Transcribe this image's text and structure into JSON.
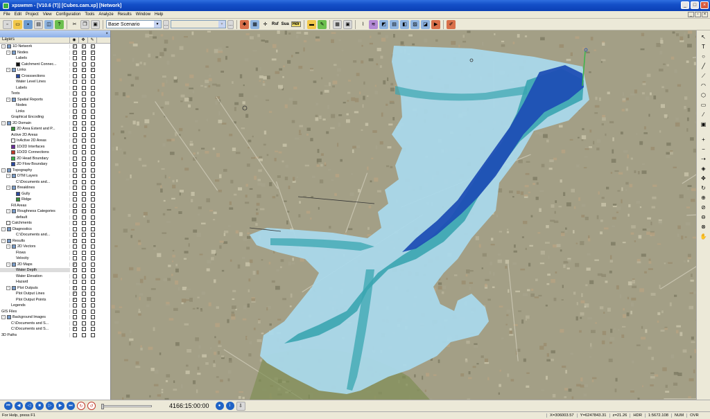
{
  "window": {
    "title": "xpswmm - [V10.6 (T)] [Cubes.cam.xp] [Network]"
  },
  "menu": [
    "File",
    "Edit",
    "Project",
    "View",
    "Configuration",
    "Tools",
    "Analyze",
    "Results",
    "Window",
    "Help"
  ],
  "toolbar": {
    "scenario": "Base Scenario",
    "rsf_label": "Rsf",
    "sua_label": "Sua",
    "hdr_label": "Hdr"
  },
  "panel": {
    "title": "",
    "column_header": "Layers"
  },
  "layers": [
    {
      "label": "1D Network",
      "indent": 0,
      "exp": "-",
      "icon": "#7a9cc8",
      "c": [
        1,
        1,
        1
      ]
    },
    {
      "label": "Nodes",
      "indent": 1,
      "exp": "-",
      "icon": "#7a9cc8",
      "c": [
        1,
        1,
        1
      ]
    },
    {
      "label": "Labels",
      "indent": 3,
      "exp": "",
      "icon": "",
      "c": [
        0,
        0,
        0
      ]
    },
    {
      "label": "Catchment Connec...",
      "indent": 3,
      "exp": "",
      "icon": "#111111",
      "c": [
        0,
        0,
        0
      ]
    },
    {
      "label": "Links",
      "indent": 1,
      "exp": "-",
      "icon": "#7a9cc8",
      "c": [
        1,
        1,
        1
      ]
    },
    {
      "label": "Crosssections",
      "indent": 3,
      "exp": "",
      "icon": "#2b4aa0",
      "c": [
        0,
        0,
        0
      ]
    },
    {
      "label": "Water Level Lines",
      "indent": 3,
      "exp": "",
      "icon": "",
      "c": [
        0,
        0,
        0
      ]
    },
    {
      "label": "Labels",
      "indent": 3,
      "exp": "",
      "icon": "",
      "c": [
        0,
        0,
        0
      ]
    },
    {
      "label": "Texts",
      "indent": 2,
      "exp": "",
      "icon": "",
      "c": [
        0,
        0,
        0
      ]
    },
    {
      "label": "Spatial Reports",
      "indent": 1,
      "exp": "-",
      "icon": "#7a9cc8",
      "c": [
        0,
        0,
        0
      ]
    },
    {
      "label": "Nodes",
      "indent": 3,
      "exp": "",
      "icon": "",
      "c": [
        0,
        0,
        0
      ]
    },
    {
      "label": "Links",
      "indent": 3,
      "exp": "",
      "icon": "",
      "c": [
        0,
        0,
        0
      ]
    },
    {
      "label": "Graphical Encoding",
      "indent": 2,
      "exp": "",
      "icon": "",
      "c": [
        1,
        0,
        0
      ]
    },
    {
      "label": "2D Domain",
      "indent": 0,
      "exp": "-",
      "icon": "#7a9cc8",
      "c": [
        0,
        0,
        0
      ]
    },
    {
      "label": "2D Area Extent and P...",
      "indent": 2,
      "exp": "",
      "icon": "#3a8f3a",
      "c": [
        0,
        0,
        0
      ]
    },
    {
      "label": "Active 2D Areas",
      "indent": 2,
      "exp": "",
      "icon": "",
      "c": [
        0,
        0,
        0
      ]
    },
    {
      "label": "InActive 2D Areas",
      "indent": 2,
      "exp": "",
      "icon": "#ffffff",
      "c": [
        0,
        0,
        0
      ]
    },
    {
      "label": "1D/2D Interfaces",
      "indent": 2,
      "exp": "",
      "icon": "#6a2c9c",
      "c": [
        0,
        0,
        0
      ]
    },
    {
      "label": "1D/2D Connections",
      "indent": 2,
      "exp": "",
      "icon": "#c0392b",
      "c": [
        0,
        0,
        0
      ]
    },
    {
      "label": "2D Head Boundary",
      "indent": 2,
      "exp": "",
      "icon": "#3bb04a",
      "c": [
        0,
        0,
        0
      ]
    },
    {
      "label": "2D Flow Boundary",
      "indent": 2,
      "exp": "",
      "icon": "#2b4aa0",
      "c": [
        0,
        0,
        0
      ]
    },
    {
      "label": "Topography",
      "indent": 0,
      "exp": "-",
      "icon": "#7a9cc8",
      "c": [
        0,
        0,
        0
      ]
    },
    {
      "label": "DTM Layers",
      "indent": 1,
      "exp": "-",
      "icon": "#7a9cc8",
      "c": [
        0,
        0,
        0
      ]
    },
    {
      "label": "C:\\Documents and...",
      "indent": 3,
      "exp": "",
      "icon": "",
      "c": [
        0,
        0,
        0
      ]
    },
    {
      "label": "Breaklines",
      "indent": 1,
      "exp": "-",
      "icon": "#7a9cc8",
      "c": [
        0,
        0,
        0
      ]
    },
    {
      "label": "Gully",
      "indent": 3,
      "exp": "",
      "icon": "#2b4aa0",
      "c": [
        0,
        0,
        0
      ]
    },
    {
      "label": "Ridge",
      "indent": 3,
      "exp": "",
      "icon": "#3a8f3a",
      "c": [
        0,
        0,
        0
      ]
    },
    {
      "label": "Fill Areas",
      "indent": 2,
      "exp": "",
      "icon": "",
      "c": [
        0,
        0,
        0
      ]
    },
    {
      "label": "Roughness Categories",
      "indent": 1,
      "exp": "-",
      "icon": "#7a9cc8",
      "c": [
        1,
        1,
        1
      ]
    },
    {
      "label": "default",
      "indent": 3,
      "exp": "",
      "icon": "",
      "c": [
        0,
        0,
        0
      ]
    },
    {
      "label": "Catchments",
      "indent": 1,
      "exp": "",
      "icon": "#ffffff",
      "c": [
        0,
        0,
        0
      ]
    },
    {
      "label": "Diagnostics",
      "indent": 0,
      "exp": "-",
      "icon": "#7a9cc8",
      "c": [
        0,
        0,
        0
      ]
    },
    {
      "label": "C:\\Documents and...",
      "indent": 3,
      "exp": "",
      "icon": "",
      "c": [
        0,
        0,
        0
      ]
    },
    {
      "label": "Results",
      "indent": 0,
      "exp": "-",
      "icon": "#7a9cc8",
      "c": [
        1,
        0,
        0
      ]
    },
    {
      "label": "2D Vectors",
      "indent": 1,
      "exp": "-",
      "icon": "#7a9cc8",
      "c": [
        0,
        0,
        0
      ]
    },
    {
      "label": "Flows",
      "indent": 3,
      "exp": "",
      "icon": "",
      "c": [
        0,
        0,
        0
      ]
    },
    {
      "label": "Velocity",
      "indent": 3,
      "exp": "",
      "icon": "",
      "c": [
        0,
        0,
        0
      ]
    },
    {
      "label": "2D Maps",
      "indent": 1,
      "exp": "-",
      "icon": "#7a9cc8",
      "c": [
        1,
        0,
        0
      ]
    },
    {
      "label": "Water Depth",
      "indent": 3,
      "exp": "",
      "icon": "",
      "c": [
        1,
        0,
        0
      ],
      "sel": true
    },
    {
      "label": "Water Elevation",
      "indent": 3,
      "exp": "",
      "icon": "",
      "c": [
        0,
        0,
        0
      ]
    },
    {
      "label": "Hazard",
      "indent": 3,
      "exp": "",
      "icon": "",
      "c": [
        0,
        0,
        0
      ]
    },
    {
      "label": "Plot Outputs",
      "indent": 1,
      "exp": "-",
      "icon": "#7a9cc8",
      "c": [
        1,
        0,
        0
      ]
    },
    {
      "label": "Plot Output Lines",
      "indent": 3,
      "exp": "",
      "icon": "",
      "c": [
        1,
        0,
        0
      ]
    },
    {
      "label": "Plot Output Points",
      "indent": 3,
      "exp": "",
      "icon": "",
      "c": [
        1,
        0,
        0
      ]
    },
    {
      "label": "Legends",
      "indent": 2,
      "exp": "",
      "icon": "",
      "c": [
        0,
        0,
        0
      ]
    },
    {
      "label": "GIS Files",
      "indent": 0,
      "exp": "",
      "icon": "",
      "c": [
        0,
        0,
        0
      ]
    },
    {
      "label": "Background Images",
      "indent": 0,
      "exp": "-",
      "icon": "#7a9cc8",
      "c": [
        0,
        0,
        0
      ]
    },
    {
      "label": "C:\\Documents and S...",
      "indent": 2,
      "exp": "",
      "icon": "",
      "c": [
        0,
        0,
        0
      ]
    },
    {
      "label": "C:\\Documents and S...",
      "indent": 2,
      "exp": "",
      "icon": "",
      "c": [
        1,
        0,
        0
      ]
    },
    {
      "label": "3D Paths",
      "indent": 0,
      "exp": "",
      "icon": "",
      "c": [
        0,
        0,
        0
      ]
    }
  ],
  "animation": {
    "time": "4166:15:00:00"
  },
  "status": {
    "help": "For Help, press F1",
    "x": "X=306003.57",
    "y": "Y=6247843.31",
    "z": "z=21.26",
    "hdr": "HDR",
    "scale": "1:5672.108",
    "num": "NUM",
    "ovr": "OVR"
  },
  "colors": {
    "shallow": "#aad8ea",
    "medium": "#3aa5b0",
    "deep": "#1f4fb5",
    "ground": "#a39f86"
  }
}
